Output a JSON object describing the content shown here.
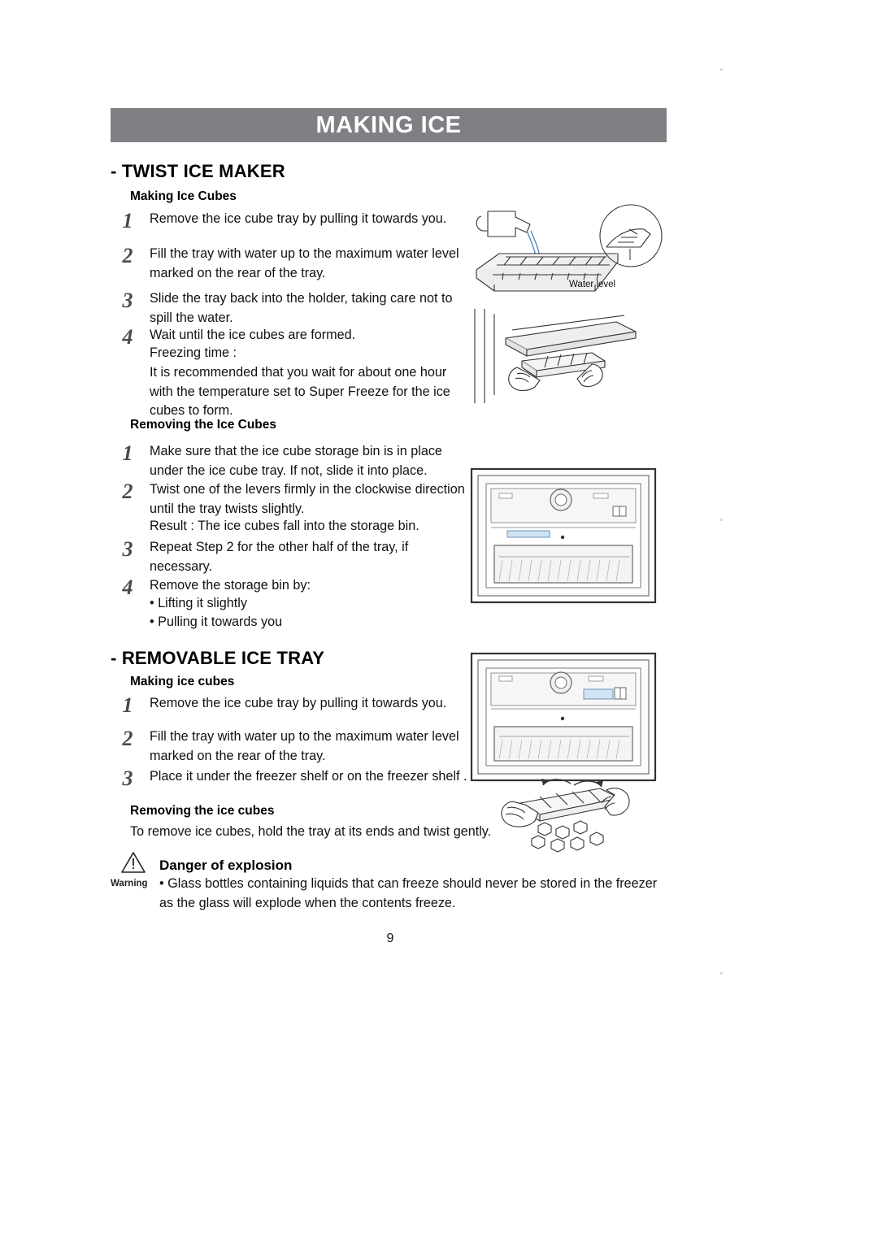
{
  "document": {
    "title": "MAKING ICE",
    "page_number": "9"
  },
  "sections": [
    {
      "heading": "- TWIST ICE MAKER",
      "sub_sections": [
        {
          "heading": "Making Ice Cubes",
          "steps": [
            {
              "num": "1",
              "text": "Remove the ice cube tray by pulling it towards you."
            },
            {
              "num": "2",
              "text": "Fill the tray with water up to the maximum water level marked on the rear of the tray."
            },
            {
              "num": "3",
              "text": "Slide the tray back into the holder, taking care not to spill the water."
            },
            {
              "num": "4",
              "text": "Wait until the ice cubes are formed."
            }
          ],
          "extra_lines": [
            "Freezing time :",
            "It is recommended that you wait for about one hour with the temperature set to Super Freeze for the ice cubes to form."
          ]
        },
        {
          "heading": "Removing the Ice Cubes",
          "steps": [
            {
              "num": "1",
              "text": "Make sure that the ice cube storage bin is in place under the ice cube tray. If not, slide it into place."
            },
            {
              "num": "2",
              "text": "Twist one of the levers firmly in the clockwise direction until the tray twists slightly."
            },
            {
              "num": "3",
              "text": "Repeat Step 2 for the other half of the tray, if necessary."
            },
            {
              "num": "4",
              "text": "Remove the storage bin by:"
            }
          ],
          "extra_lines": [
            "Result : The ice cubes fall into the storage bin."
          ],
          "bullets": [
            "• Lifting it slightly",
            "• Pulling it towards you"
          ]
        }
      ]
    },
    {
      "heading": "- REMOVABLE ICE TRAY",
      "sub_sections": [
        {
          "heading": "Making ice cubes",
          "steps": [
            {
              "num": "1",
              "text": "Remove the ice cube tray by pulling it towards you."
            },
            {
              "num": "2",
              "text": "Fill the tray with water up to the maximum water level marked on the rear of the tray."
            },
            {
              "num": "3",
              "text": "Place it under the freezer shelf or on the freezer shelf ."
            }
          ]
        },
        {
          "heading": "Removing the ice cubes",
          "paragraph": "To remove ice cubes, hold the tray at its ends and twist gently."
        }
      ]
    }
  ],
  "warning": {
    "icon_label": "Warning",
    "title": "Danger of explosion",
    "text": "• Glass bottles containing liquids that can freeze should never be stored in the freezer as the glass will explode when the contents freeze."
  },
  "illustrations": {
    "water_level_caption": "Water level"
  }
}
